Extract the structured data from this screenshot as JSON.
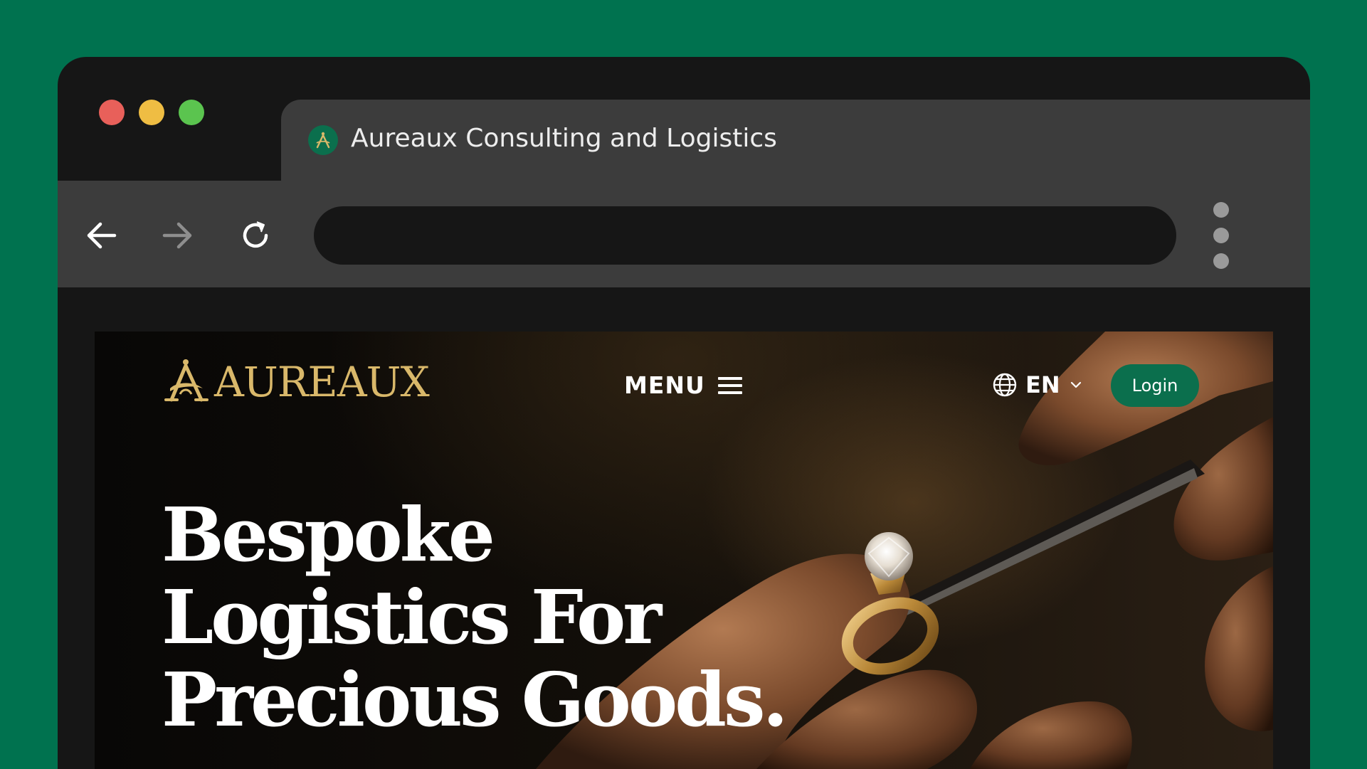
{
  "browser": {
    "tab_title": "Aureaux Consulting and Logistics",
    "favicon": "aureaux-monogram-icon",
    "address_value": "",
    "nav_icons": [
      "back-arrow-icon",
      "forward-arrow-icon",
      "reload-icon"
    ],
    "menu_icon": "kebab-menu-icon"
  },
  "site": {
    "brand": "AUREAUX",
    "menu_label": "MENU",
    "language": "EN",
    "login_label": "Login",
    "headline": "Bespoke Logistics For Precious Goods."
  },
  "colors": {
    "background": "#00724f",
    "brand_gold": "#d9b86a",
    "accent_green": "#0b6f4d",
    "chrome_dark": "#161616",
    "chrome_mid": "#3c3c3c"
  }
}
